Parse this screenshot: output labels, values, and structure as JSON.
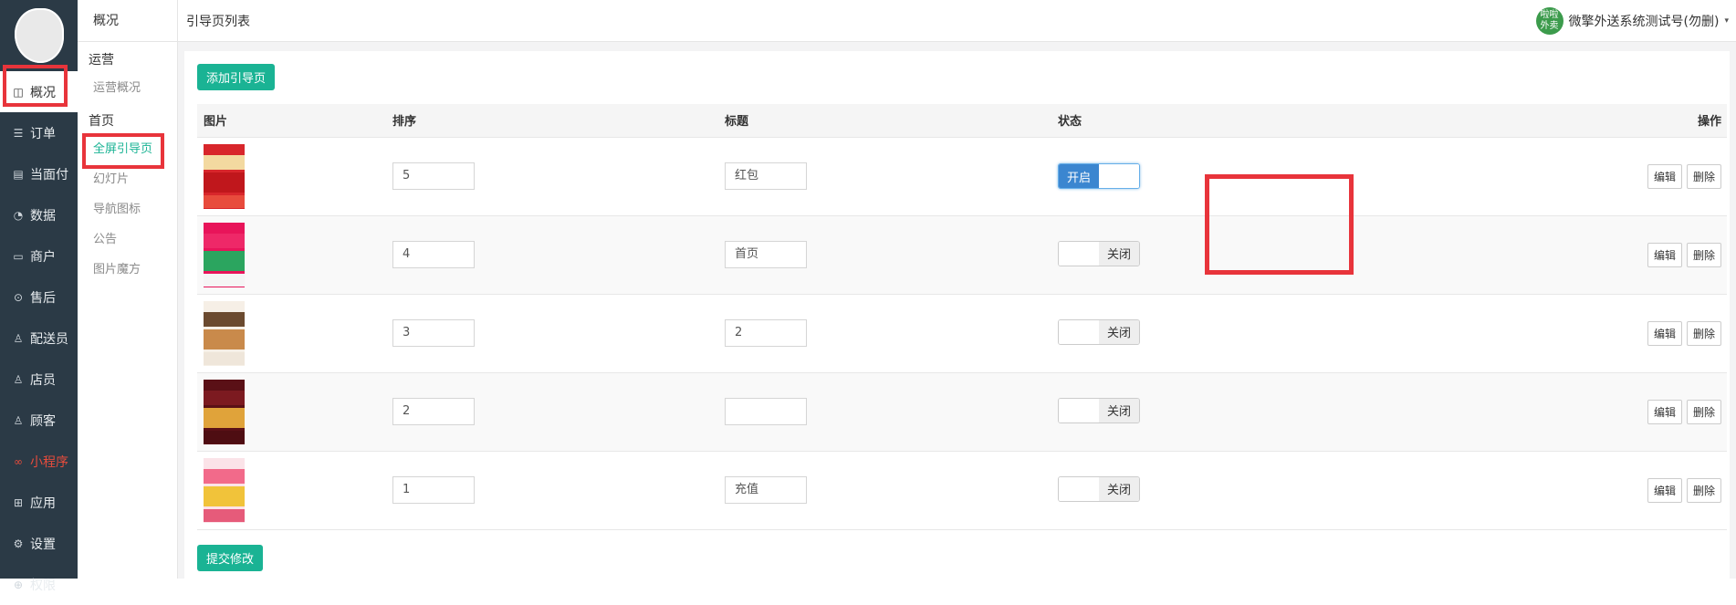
{
  "sidebar": {
    "items": [
      {
        "label": "概况",
        "icon": "overview-icon",
        "glyph": "◫",
        "active": true
      },
      {
        "label": "订单",
        "icon": "order-icon",
        "glyph": "☰"
      },
      {
        "label": "当面付",
        "icon": "pay-icon",
        "glyph": "▤"
      },
      {
        "label": "数据",
        "icon": "data-icon",
        "glyph": "◔"
      },
      {
        "label": "商户",
        "icon": "store-icon",
        "glyph": "▭"
      },
      {
        "label": "售后",
        "icon": "aftersale-icon",
        "glyph": "⊙"
      },
      {
        "label": "配送员",
        "icon": "courier-icon",
        "glyph": "♙"
      },
      {
        "label": "店员",
        "icon": "clerk-icon",
        "glyph": "♙"
      },
      {
        "label": "顾客",
        "icon": "customer-icon",
        "glyph": "♙"
      },
      {
        "label": "小程序",
        "icon": "miniprogram-icon",
        "glyph": "∞",
        "highlight": true
      },
      {
        "label": "应用",
        "icon": "apps-icon",
        "glyph": "⊞"
      },
      {
        "label": "设置",
        "icon": "settings-icon",
        "glyph": "⚙"
      },
      {
        "label": "权限",
        "icon": "permission-icon",
        "glyph": "⊕"
      }
    ]
  },
  "subnav": {
    "title": "概况",
    "groups": [
      {
        "label": "运营",
        "links": [
          {
            "label": "运营概况"
          }
        ]
      },
      {
        "label": "首页",
        "links": [
          {
            "label": "全屏引导页",
            "active": true
          },
          {
            "label": "幻灯片"
          },
          {
            "label": "导航图标"
          },
          {
            "label": "公告"
          },
          {
            "label": "图片魔方"
          }
        ]
      }
    ]
  },
  "header": {
    "title": "引导页列表",
    "shop_logo_line1": "啦啦",
    "shop_logo_line2": "外卖",
    "shop_name": "微擎外送系统测试号(勿删)",
    "caret": "▾"
  },
  "toolbar": {
    "add_label": "添加引导页",
    "submit_label": "提交修改"
  },
  "table": {
    "headers": {
      "image": "图片",
      "order": "排序",
      "title": "标题",
      "status": "状态",
      "actions": "操作"
    },
    "rows": [
      {
        "order": "5",
        "title": "红包",
        "status": "开启",
        "on": true,
        "edit": "编辑",
        "delete": "删除",
        "thumb": [
          "#d8262b",
          "#f3d9a0",
          "#c0171c",
          "#e84b3c"
        ]
      },
      {
        "order": "4",
        "title": "首页",
        "status": "关闭",
        "on": false,
        "edit": "编辑",
        "delete": "删除",
        "thumb": [
          "#e8145a",
          "#ee2868",
          "#2ba55f",
          "#f5f5f5"
        ]
      },
      {
        "order": "3",
        "title": "2",
        "status": "关闭",
        "on": false,
        "edit": "编辑",
        "delete": "删除",
        "thumb": [
          "#f6efe6",
          "#6b4a2f",
          "#c98a4b",
          "#efe6da"
        ]
      },
      {
        "order": "2",
        "title": "",
        "status": "关闭",
        "on": false,
        "edit": "编辑",
        "delete": "删除",
        "thumb": [
          "#5a1016",
          "#7c1a20",
          "#e0a33a",
          "#4e0d12"
        ]
      },
      {
        "order": "1",
        "title": "充值",
        "status": "关闭",
        "on": false,
        "edit": "编辑",
        "delete": "删除",
        "thumb": [
          "#fbe3e8",
          "#f26a8a",
          "#f1c33a",
          "#e65b7a"
        ]
      }
    ]
  },
  "colors": {
    "accent": "#1ab394",
    "sidebar": "#2b3a46",
    "switch_on": "#3b86d0",
    "annotation_red": "#e8343b"
  }
}
